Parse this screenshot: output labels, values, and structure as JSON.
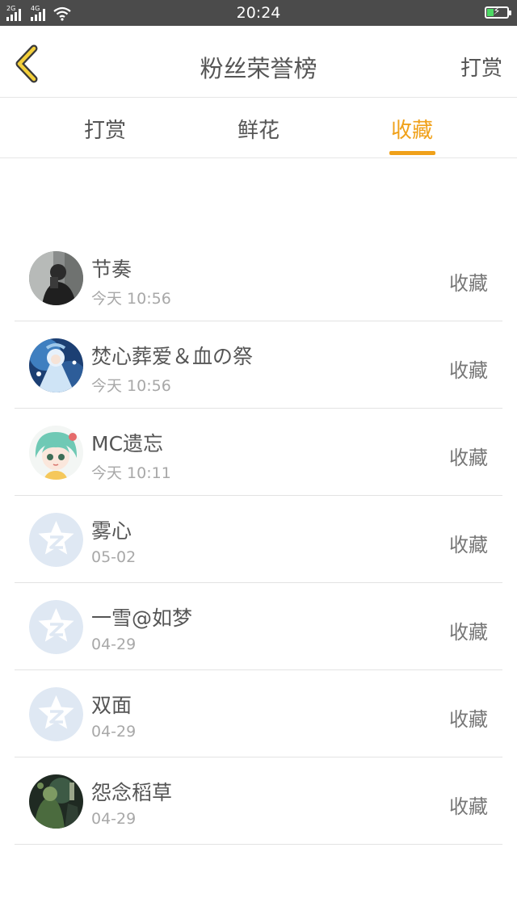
{
  "status_bar": {
    "time": "20:24",
    "net1": "2G",
    "net2": "4G"
  },
  "header": {
    "title": "粉丝荣誉榜",
    "right_action": "打赏",
    "back_icon": "chevron-left-icon",
    "accent_color": "#f0a11a"
  },
  "tabs": [
    {
      "label": "打赏",
      "active": false
    },
    {
      "label": "鲜花",
      "active": false
    },
    {
      "label": "收藏",
      "active": true
    }
  ],
  "list": [
    {
      "name": "节奏",
      "time": "今天 10:56",
      "action": "收藏",
      "avatar": "photo-dark"
    },
    {
      "name": "焚心葬爱＆血の祭",
      "time": "今天 10:56",
      "action": "收藏",
      "avatar": "anime-blue"
    },
    {
      "name": "MC遗忘",
      "time": "今天 10:11",
      "action": "收藏",
      "avatar": "anime-green"
    },
    {
      "name": "雾心",
      "time": "05-02",
      "action": "收藏",
      "avatar": "default-qzone"
    },
    {
      "name": "一雪@如梦",
      "time": "04-29",
      "action": "收藏",
      "avatar": "default-qzone"
    },
    {
      "name": "双面",
      "time": "04-29",
      "action": "收藏",
      "avatar": "default-qzone"
    },
    {
      "name": "怨念稻草",
      "time": "04-29",
      "action": "收藏",
      "avatar": "photo-dark-green"
    }
  ]
}
